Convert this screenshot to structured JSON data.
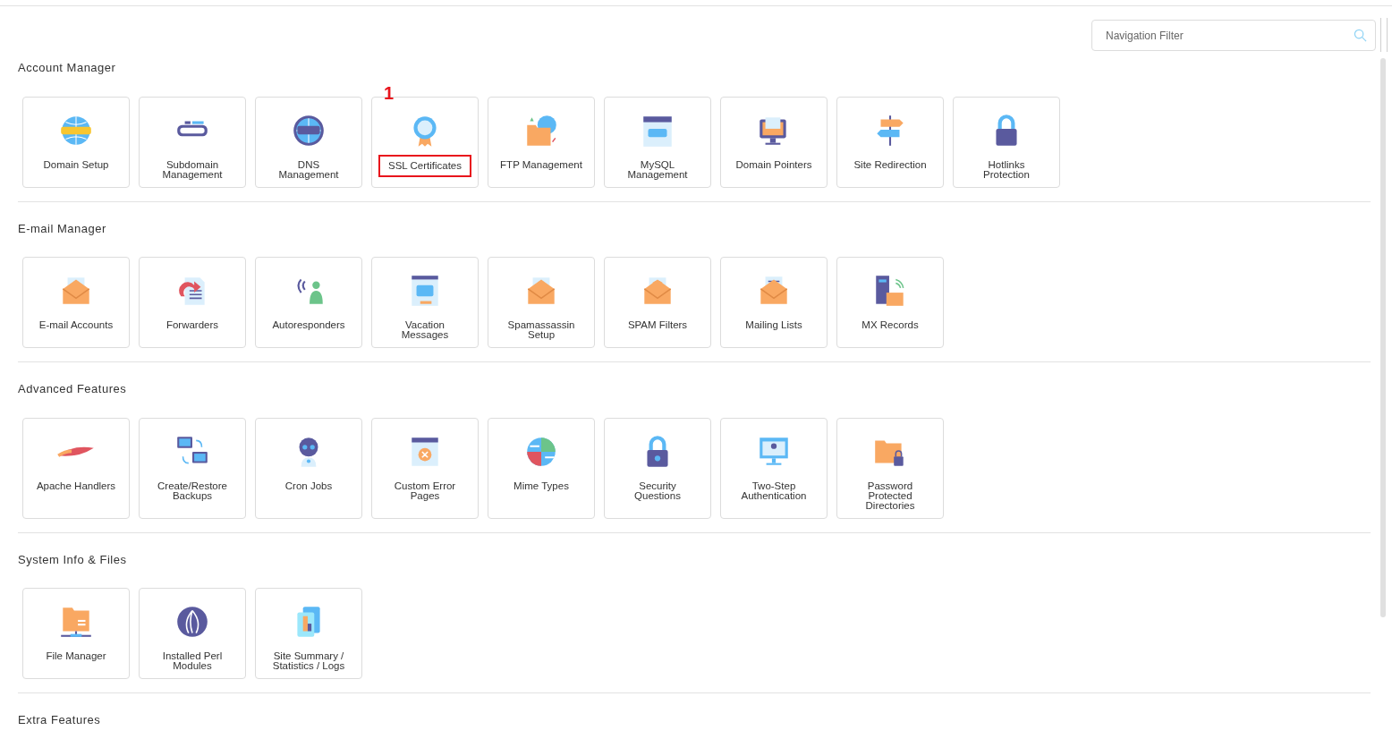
{
  "search": {
    "placeholder": "Navigation Filter"
  },
  "sections": [
    {
      "title": "Account Manager",
      "items": [
        {
          "label": "Domain Setup",
          "highlighted": false
        },
        {
          "label": "Subdomain Management",
          "highlighted": false
        },
        {
          "label": "DNS Management",
          "highlighted": false
        },
        {
          "label": "SSL Certificates",
          "highlighted": true,
          "callout": "1"
        },
        {
          "label": "FTP Management",
          "highlighted": false
        },
        {
          "label": "MySQL Management",
          "highlighted": false
        },
        {
          "label": "Domain Pointers",
          "highlighted": false
        },
        {
          "label": "Site Redirection",
          "highlighted": false
        },
        {
          "label": "Hotlinks Protection",
          "highlighted": false
        }
      ]
    },
    {
      "title": "E-mail Manager",
      "items": [
        {
          "label": "E-mail Accounts",
          "highlighted": false
        },
        {
          "label": "Forwarders",
          "highlighted": false
        },
        {
          "label": "Autoresponders",
          "highlighted": false
        },
        {
          "label": "Vacation Messages",
          "highlighted": false
        },
        {
          "label": "Spamassassin Setup",
          "highlighted": false
        },
        {
          "label": "SPAM Filters",
          "highlighted": false
        },
        {
          "label": "Mailing Lists",
          "highlighted": false
        },
        {
          "label": "MX Records",
          "highlighted": false
        }
      ]
    },
    {
      "title": "Advanced Features",
      "items": [
        {
          "label": "Apache Handlers",
          "highlighted": false
        },
        {
          "label": "Create/Restore Backups",
          "highlighted": false
        },
        {
          "label": "Cron Jobs",
          "highlighted": false
        },
        {
          "label": "Custom Error Pages",
          "highlighted": false
        },
        {
          "label": "Mime Types",
          "highlighted": false
        },
        {
          "label": "Security Questions",
          "highlighted": false
        },
        {
          "label": "Two-Step Authentication",
          "highlighted": false
        },
        {
          "label": "Password Protected Directories",
          "highlighted": false
        }
      ]
    },
    {
      "title": "System Info & Files",
      "items": [
        {
          "label": "File Manager",
          "highlighted": false
        },
        {
          "label": "Installed Perl Modules",
          "highlighted": false
        },
        {
          "label": "Site Summary / Statistics / Logs",
          "highlighted": false
        }
      ]
    },
    {
      "title": "Extra Features"
    }
  ]
}
